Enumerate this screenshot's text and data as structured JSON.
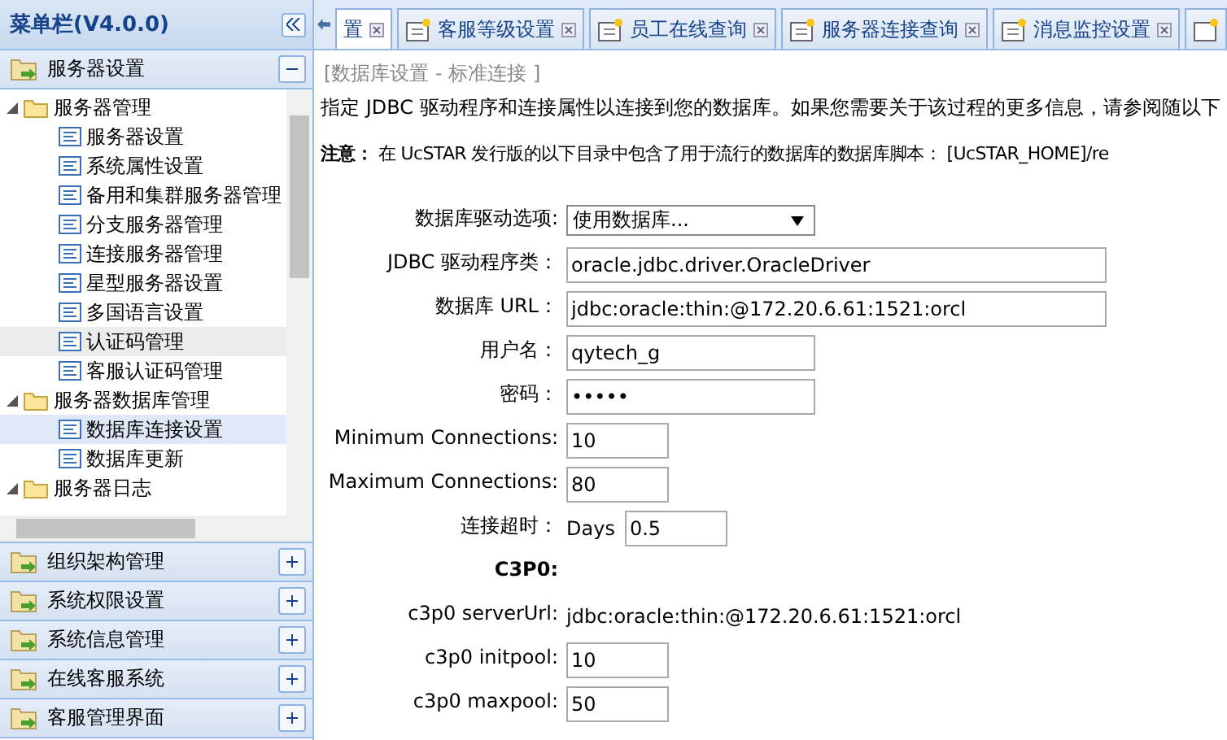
{
  "sidebar": {
    "title": "菜单栏(V4.0.0)",
    "sections": [
      {
        "label": "服务器设置",
        "expanded": true,
        "tree": [
          {
            "label": "服务器管理",
            "expanded": true,
            "children": [
              {
                "label": "服务器设置",
                "selected": false,
                "hovered": false
              },
              {
                "label": "系统属性设置",
                "selected": false,
                "hovered": false
              },
              {
                "label": "备用和集群服务器管理",
                "selected": false,
                "hovered": false
              },
              {
                "label": "分支服务器管理",
                "selected": false,
                "hovered": false
              },
              {
                "label": "连接服务器管理",
                "selected": false,
                "hovered": false
              },
              {
                "label": "星型服务器设置",
                "selected": false,
                "hovered": false
              },
              {
                "label": "多国语言设置",
                "selected": false,
                "hovered": false
              },
              {
                "label": "认证码管理",
                "selected": false,
                "hovered": true
              },
              {
                "label": "客服认证码管理",
                "selected": false,
                "hovered": false
              }
            ]
          },
          {
            "label": "服务器数据库管理",
            "expanded": true,
            "children": [
              {
                "label": "数据库连接设置",
                "selected": true,
                "hovered": false
              },
              {
                "label": "数据库更新",
                "selected": false,
                "hovered": false
              }
            ]
          },
          {
            "label": "服务器日志",
            "expanded": true
          }
        ]
      },
      {
        "label": "组织架构管理",
        "expanded": false
      },
      {
        "label": "系统权限设置",
        "expanded": false
      },
      {
        "label": "系统信息管理",
        "expanded": false
      },
      {
        "label": "在线客服系统",
        "expanded": false
      },
      {
        "label": "客服管理界面",
        "expanded": false
      }
    ]
  },
  "tabs": [
    {
      "label": "置",
      "icon": false,
      "selected": true
    },
    {
      "label": "客服等级设置",
      "icon": true,
      "selected": false
    },
    {
      "label": "员工在线查询",
      "icon": true,
      "selected": false
    },
    {
      "label": "服务器连接查询",
      "icon": true,
      "selected": false
    },
    {
      "label": "消息监控设置",
      "icon": true,
      "selected": false
    }
  ],
  "content": {
    "breadcrumb": "[数据库设置 - 标准连接 ]",
    "intro": "指定 JDBC 驱动程序和连接属性以连接到您的数据库。如果您需要关于该过程的更多信息，请参阅随以下",
    "note": "**注意：** 在 UcSTAR 发行版的以下目录中包含了用于流行的数据库的数据库脚本： [UcSTAR_HOME]/re",
    "fields": [
      {
        "kind": "select",
        "label": "数据库驱动选项:",
        "value": "使用数据库..."
      },
      {
        "kind": "wide",
        "label": "JDBC 驱动程序类：",
        "value": "oracle.jdbc.driver.OracleDriver"
      },
      {
        "kind": "wide",
        "label": "数据库 URL：",
        "value": "jdbc:oracle:thin:@172.20.6.61:1521:orcl"
      },
      {
        "kind": "medium",
        "label": "用户名：",
        "value": "qytech_g"
      },
      {
        "kind": "medium",
        "label": "密码：",
        "value": "•••••"
      },
      {
        "kind": "small",
        "label": "Minimum Connections:",
        "value": "10"
      },
      {
        "kind": "small",
        "label": "Maximum Connections:",
        "value": "80"
      },
      {
        "kind": "days",
        "label": "连接超时：",
        "unit": "Days",
        "value": "0.5"
      },
      {
        "kind": "heading",
        "label": "C3P0:"
      },
      {
        "kind": "static",
        "label": "c3p0 serverUrl:",
        "value": "jdbc:oracle:thin:@172.20.6.61:1521:orcl"
      },
      {
        "kind": "small",
        "label": "c3p0 initpool:",
        "value": "10"
      },
      {
        "kind": "small",
        "label": "c3p0 maxpool:",
        "value": "50"
      }
    ]
  }
}
